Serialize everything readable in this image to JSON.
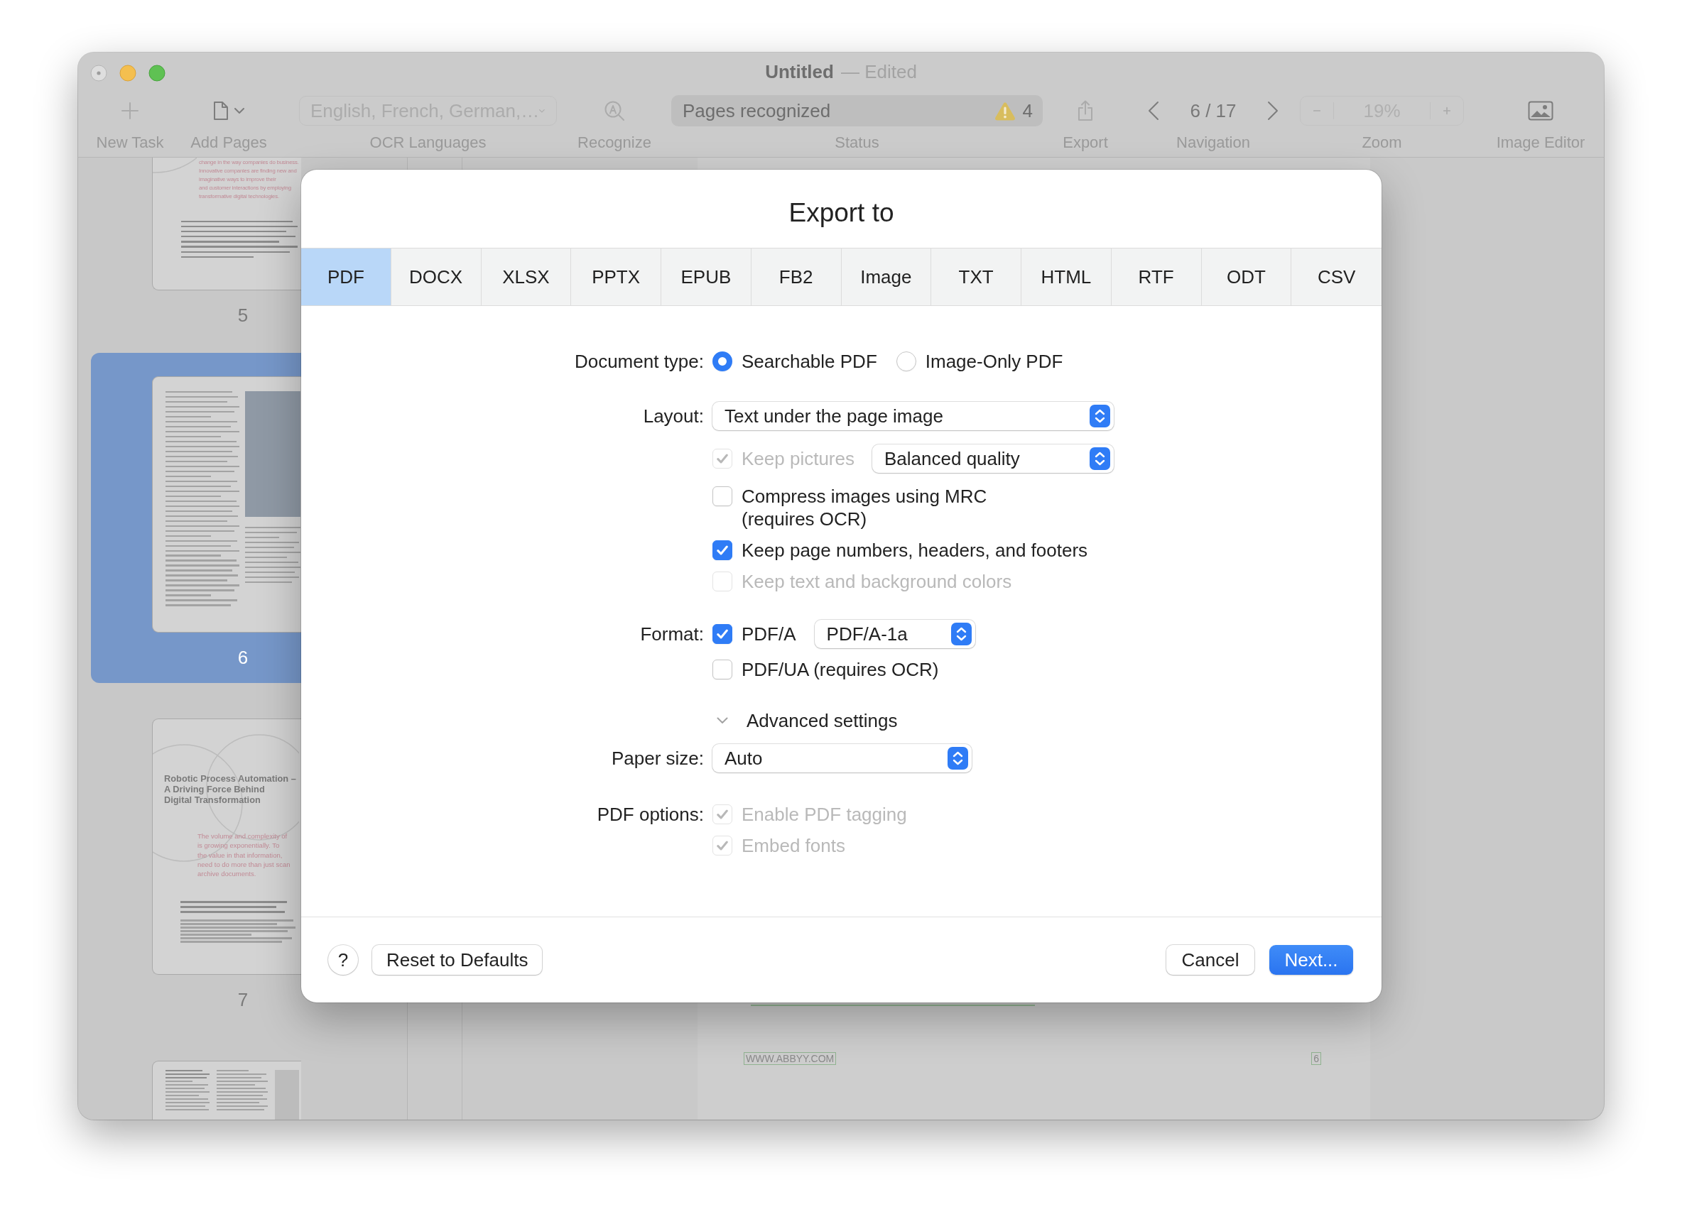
{
  "window": {
    "title": "Untitled",
    "status": "— Edited"
  },
  "toolbar": {
    "new_task": {
      "label": "New Task",
      "disabled": true
    },
    "add_pages": {
      "label": "Add Pages",
      "disabled": false
    },
    "ocr_languages": {
      "value": "English, French, German,…",
      "label": "OCR Languages",
      "disabled": true
    },
    "recognize": {
      "label": "Recognize",
      "disabled": true
    },
    "status": {
      "text": "Pages recognized",
      "warnings": "4",
      "label": "Status"
    },
    "export": {
      "label": "Export",
      "disabled": true
    },
    "navigation": {
      "page": "6 / 17",
      "label": "Navigation"
    },
    "zoom": {
      "value": "19%",
      "label": "Zoom",
      "disabled": true
    },
    "image_editor": {
      "label": "Image Editor",
      "disabled": false
    }
  },
  "sidebar": {
    "pages": [
      {
        "kind": "quote",
        "number": "5",
        "selected": false,
        "quote": "change in the way companies do business.\nInnovative companies are finding new and\nimaginative ways to improve their\nand customer interactions by employing\ntransformative digital technologies."
      },
      {
        "kind": "photo",
        "number": "6",
        "selected": true
      },
      {
        "kind": "chapter",
        "number": "7",
        "selected": false,
        "heading": "Robotic Process Automation –\nA Driving Force Behind\nDigital Transformation",
        "quote": "The volume and complexity of\nis growing exponentially. To\nthe value in that information,\nneed to do more than just scan\narchive documents."
      },
      {
        "kind": "columns",
        "selected": false
      }
    ]
  },
  "document": {
    "footer_text": "WWW.ABBYY.COM",
    "page_number": "6"
  },
  "dialog": {
    "title": "Export to",
    "tabs": [
      {
        "label": "PDF",
        "selected": true
      },
      {
        "label": "DOCX",
        "selected": false
      },
      {
        "label": "XLSX",
        "selected": false
      },
      {
        "label": "PPTX",
        "selected": false
      },
      {
        "label": "EPUB",
        "selected": false
      },
      {
        "label": "FB2",
        "selected": false
      },
      {
        "label": "Image",
        "selected": false
      },
      {
        "label": "TXT",
        "selected": false
      },
      {
        "label": "HTML",
        "selected": false
      },
      {
        "label": "RTF",
        "selected": false
      },
      {
        "label": "ODT",
        "selected": false
      },
      {
        "label": "CSV",
        "selected": false
      }
    ],
    "document_type": {
      "label": "Document type:",
      "options": [
        {
          "text": "Searchable PDF",
          "selected": true
        },
        {
          "text": "Image-Only PDF",
          "selected": false
        }
      ]
    },
    "layout": {
      "label": "Layout:",
      "value": "Text under the page image",
      "keep_pictures": {
        "text": "Keep pictures",
        "checked": true,
        "disabled": true,
        "quality": "Balanced quality"
      },
      "options": [
        {
          "text": "Compress images using MRC\n(requires OCR)",
          "checked": false,
          "disabled": false
        },
        {
          "text": "Keep page numbers, headers, and footers",
          "checked": true,
          "disabled": false
        },
        {
          "text": "Keep text and background colors",
          "checked": false,
          "disabled": true
        }
      ]
    },
    "format": {
      "label": "Format:",
      "pdf_a": {
        "text": "PDF/A",
        "checked": true,
        "disabled": false,
        "version": "PDF/A-1a"
      },
      "options": [
        {
          "text": "PDF/UA (requires OCR)",
          "checked": false,
          "disabled": false
        }
      ]
    },
    "advanced": {
      "text": "Advanced settings",
      "expanded": true
    },
    "paper_size": {
      "label": "Paper size:",
      "value": "Auto"
    },
    "pdf_options": {
      "label": "PDF options:",
      "options": [
        {
          "text": "Enable PDF tagging",
          "checked": true,
          "disabled": true
        },
        {
          "text": "Embed fonts",
          "checked": true,
          "disabled": true
        }
      ]
    },
    "footer": {
      "help": "?",
      "reset": "Reset to Defaults",
      "cancel": "Cancel",
      "next": "Next..."
    }
  }
}
